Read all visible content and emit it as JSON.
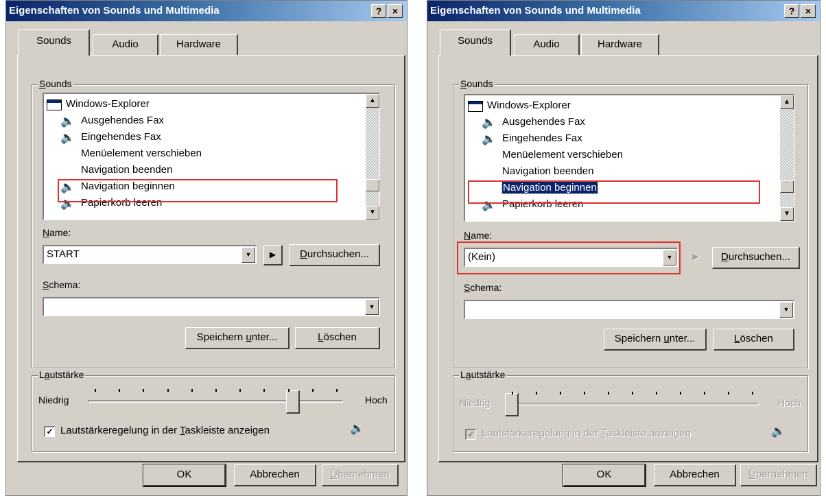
{
  "dialogs": [
    {
      "title": "Eigenschaften von Sounds und Multimedia",
      "help_label": "?",
      "close_label": "×",
      "tabs": [
        "Sounds",
        "Audio",
        "Hardware"
      ],
      "sounds_group_label": "Sounds",
      "sound_events": [
        {
          "label": "Windows-Explorer",
          "icon": "window-icon",
          "has_sound": false
        },
        {
          "label": "Ausgehendes Fax",
          "icon": "speaker-icon",
          "has_sound": true
        },
        {
          "label": "Eingehendes Fax",
          "icon": "speaker-icon",
          "has_sound": true
        },
        {
          "label": "Menüelement verschieben",
          "icon": "",
          "has_sound": false
        },
        {
          "label": "Navigation beenden",
          "icon": "",
          "has_sound": false
        },
        {
          "label": "Navigation beginnen",
          "icon": "speaker-icon",
          "has_sound": true,
          "highlighted": true
        },
        {
          "label": "Papierkorb leeren",
          "icon": "speaker-icon",
          "has_sound": true
        }
      ],
      "name_label": "Name:",
      "name_value": "START",
      "play_enabled": true,
      "browse_label": "Durchsuchen...",
      "schema_label": "Schema:",
      "schema_value": "",
      "save_as_label": "Speichern unter...",
      "delete_label": "Löschen",
      "volume_group_label": "Lautstärke",
      "volume_low": "Niedrig",
      "volume_high": "Hoch",
      "volume_level": 0.82,
      "volume_enabled": true,
      "taskbar_checkbox_label": "Lautstärkeregelung in der Taskleiste anzeigen",
      "taskbar_checked": true,
      "ok_label": "OK",
      "cancel_label": "Abbrechen",
      "apply_label": "Übernehmen"
    },
    {
      "title": "Eigenschaften von Sounds und Multimedia",
      "help_label": "?",
      "close_label": "×",
      "tabs": [
        "Sounds",
        "Audio",
        "Hardware"
      ],
      "sounds_group_label": "Sounds",
      "sound_events": [
        {
          "label": "Windows-Explorer",
          "icon": "window-icon",
          "has_sound": false
        },
        {
          "label": "Ausgehendes Fax",
          "icon": "speaker-icon",
          "has_sound": true
        },
        {
          "label": "Eingehendes Fax",
          "icon": "speaker-icon",
          "has_sound": true
        },
        {
          "label": "Menüelement verschieben",
          "icon": "",
          "has_sound": false
        },
        {
          "label": "Navigation beenden",
          "icon": "",
          "has_sound": false
        },
        {
          "label": "Navigation beginnen",
          "icon": "",
          "has_sound": false,
          "selected": true,
          "highlighted": true
        },
        {
          "label": "Papierkorb leeren",
          "icon": "speaker-icon",
          "has_sound": true
        }
      ],
      "name_label": "Name:",
      "name_value": "(Kein)",
      "play_enabled": false,
      "browse_label": "Durchsuchen...",
      "schema_label": "Schema:",
      "schema_value": "",
      "save_as_label": "Speichern unter...",
      "delete_label": "Löschen",
      "volume_group_label": "Lautstärke",
      "volume_low": "Niedrig",
      "volume_high": "Hoch",
      "volume_level": 0.0,
      "volume_enabled": false,
      "taskbar_checkbox_label": "Lautstärkeregelung in der Taskleiste anzeigen",
      "taskbar_checked": true,
      "ok_label": "OK",
      "cancel_label": "Abbrechen",
      "apply_label": "Übernehmen"
    }
  ],
  "colors": {
    "highlight_box": "#e03030",
    "titlebar_start": "#0a246a",
    "titlebar_end": "#a6caf0",
    "selection": "#0a246a",
    "dialog_face": "#d4d0c8"
  }
}
